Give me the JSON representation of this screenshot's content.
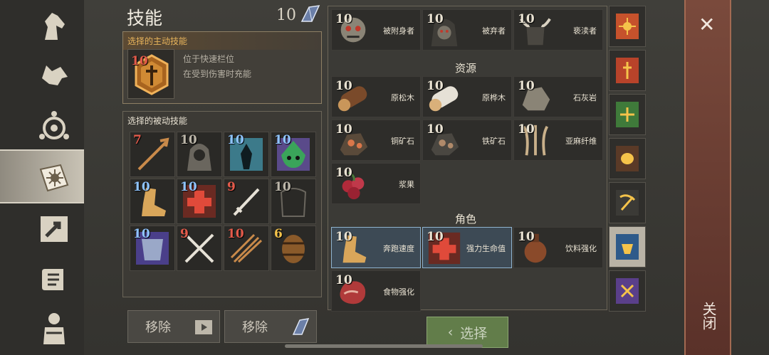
{
  "header": {
    "title": "技能",
    "points": "10"
  },
  "active_skill": {
    "title": "选择的主动技能",
    "level": "10",
    "desc_line1": "位于快速栏位",
    "desc_line2": "在受到伤害时充能"
  },
  "passive_skills": {
    "title": "选择的被动技能",
    "items": [
      {
        "level": "7",
        "color": "#e35a4a",
        "icon": "spear-icon"
      },
      {
        "level": "10",
        "color": "#bcb6a9",
        "icon": "hooded-knight-icon"
      },
      {
        "level": "10",
        "color": "#8fc4ff",
        "icon": "glowing-figure-icon"
      },
      {
        "level": "10",
        "color": "#8fc4ff",
        "icon": "poison-skull-icon"
      },
      {
        "level": "10",
        "color": "#8fc4ff",
        "icon": "running-boot-icon"
      },
      {
        "level": "10",
        "color": "#8fc4ff",
        "icon": "health-cross-icon"
      },
      {
        "level": "9",
        "color": "#e35a4a",
        "icon": "sword-icon"
      },
      {
        "level": "10",
        "color": "#bcb6a9",
        "icon": "armor-icon"
      },
      {
        "level": "10",
        "color": "#8fc4ff",
        "icon": "chestplate-icon"
      },
      {
        "level": "9",
        "color": "#e35a4a",
        "icon": "crossed-swords-icon"
      },
      {
        "level": "10",
        "color": "#e35a4a",
        "icon": "arrows-icon"
      },
      {
        "level": "6",
        "color": "#f5c34a",
        "icon": "barrel-icon"
      }
    ]
  },
  "remove_buttons": {
    "video_label": "移除",
    "gem_label": "移除"
  },
  "list": {
    "section_resources": "资源",
    "section_character": "角色",
    "enemies": [
      {
        "level": "10",
        "name": "被附身者",
        "icon": "zombie-head-icon"
      },
      {
        "level": "10",
        "name": "被弃者",
        "icon": "hooded-zombie-icon"
      },
      {
        "level": "10",
        "name": "亵渎者",
        "icon": "horned-helmet-icon"
      }
    ],
    "resources": [
      {
        "level": "10",
        "name": "原松木",
        "icon": "pine-log-icon"
      },
      {
        "level": "10",
        "name": "原桦木",
        "icon": "birch-log-icon"
      },
      {
        "level": "10",
        "name": "石灰岩",
        "icon": "limestone-icon"
      },
      {
        "level": "10",
        "name": "铜矿石",
        "icon": "copper-ore-icon"
      },
      {
        "level": "10",
        "name": "铁矿石",
        "icon": "iron-ore-icon"
      },
      {
        "level": "10",
        "name": "亚麻纤维",
        "icon": "flax-fiber-icon"
      },
      {
        "level": "10",
        "name": "浆果",
        "icon": "berries-icon"
      }
    ],
    "character": [
      {
        "level": "10",
        "name": "奔跑速度",
        "icon": "running-boot-icon",
        "selected": true
      },
      {
        "level": "10",
        "name": "强力生命值",
        "icon": "health-cross-icon",
        "selected": true
      },
      {
        "level": "10",
        "name": "饮料强化",
        "icon": "flask-icon",
        "selected": false
      },
      {
        "level": "10",
        "name": "食物强化",
        "icon": "meat-icon",
        "selected": false
      }
    ]
  },
  "select_button": {
    "label": "选择"
  },
  "close": {
    "label": "关闭"
  }
}
